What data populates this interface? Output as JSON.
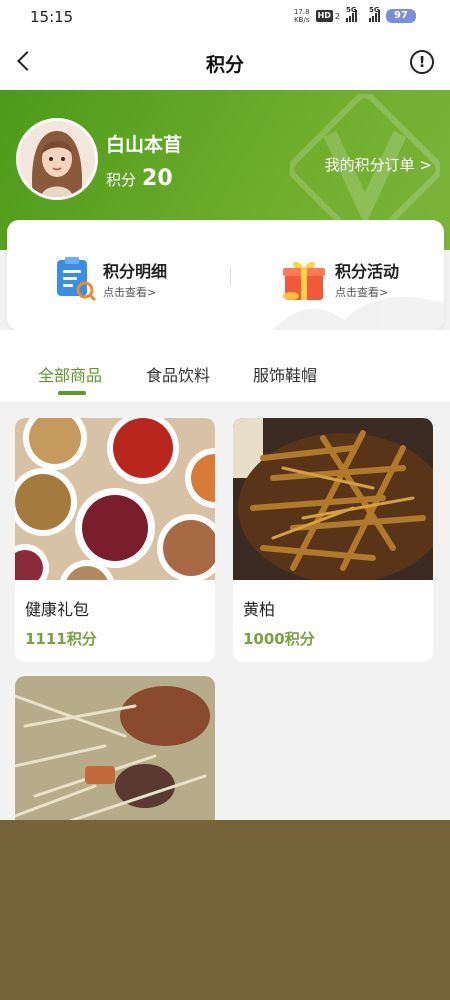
{
  "status_bar": {
    "time": "15:15",
    "net_speed_value": "17.8",
    "net_speed_unit": "KB/s",
    "hd_badge": "HD",
    "hd_sub": "2",
    "signal1_label": "5G",
    "signal2_label": "5G",
    "battery": "97"
  },
  "nav": {
    "title": "积分"
  },
  "profile": {
    "name": "白山本苜",
    "points_label": "积分",
    "points_value": "20",
    "orders_link": "我的积分订单 >"
  },
  "quick_actions": [
    {
      "title": "积分明细",
      "subtitle": "点击查看>"
    },
    {
      "title": "积分活动",
      "subtitle": "点击查看>"
    }
  ],
  "tabs": [
    "全部商品",
    "食品饮料",
    "服饰鞋帽"
  ],
  "products": [
    {
      "name": "健康礼包",
      "price": "1111积分"
    },
    {
      "name": "黄柏",
      "price": "1000积分"
    },
    {
      "name": "",
      "price": ""
    }
  ],
  "colors": {
    "accent_green": "#5a9a25",
    "price_green": "#7aa043",
    "bottom_band": "#776338"
  }
}
